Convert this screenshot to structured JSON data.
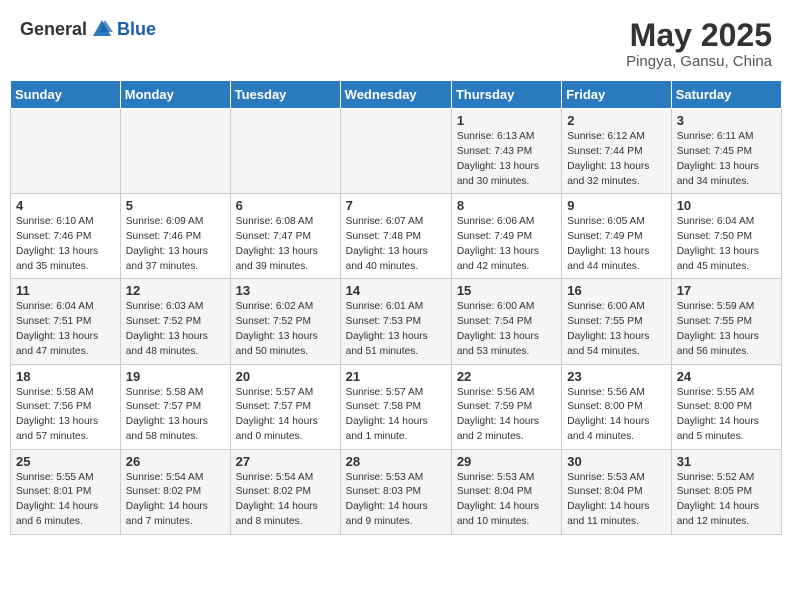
{
  "header": {
    "logo_general": "General",
    "logo_blue": "Blue",
    "month_title": "May 2025",
    "subtitle": "Pingya, Gansu, China"
  },
  "weekdays": [
    "Sunday",
    "Monday",
    "Tuesday",
    "Wednesday",
    "Thursday",
    "Friday",
    "Saturday"
  ],
  "weeks": [
    [
      {
        "day": "",
        "content": ""
      },
      {
        "day": "",
        "content": ""
      },
      {
        "day": "",
        "content": ""
      },
      {
        "day": "",
        "content": ""
      },
      {
        "day": "1",
        "content": "Sunrise: 6:13 AM\nSunset: 7:43 PM\nDaylight: 13 hours\nand 30 minutes."
      },
      {
        "day": "2",
        "content": "Sunrise: 6:12 AM\nSunset: 7:44 PM\nDaylight: 13 hours\nand 32 minutes."
      },
      {
        "day": "3",
        "content": "Sunrise: 6:11 AM\nSunset: 7:45 PM\nDaylight: 13 hours\nand 34 minutes."
      }
    ],
    [
      {
        "day": "4",
        "content": "Sunrise: 6:10 AM\nSunset: 7:46 PM\nDaylight: 13 hours\nand 35 minutes."
      },
      {
        "day": "5",
        "content": "Sunrise: 6:09 AM\nSunset: 7:46 PM\nDaylight: 13 hours\nand 37 minutes."
      },
      {
        "day": "6",
        "content": "Sunrise: 6:08 AM\nSunset: 7:47 PM\nDaylight: 13 hours\nand 39 minutes."
      },
      {
        "day": "7",
        "content": "Sunrise: 6:07 AM\nSunset: 7:48 PM\nDaylight: 13 hours\nand 40 minutes."
      },
      {
        "day": "8",
        "content": "Sunrise: 6:06 AM\nSunset: 7:49 PM\nDaylight: 13 hours\nand 42 minutes."
      },
      {
        "day": "9",
        "content": "Sunrise: 6:05 AM\nSunset: 7:49 PM\nDaylight: 13 hours\nand 44 minutes."
      },
      {
        "day": "10",
        "content": "Sunrise: 6:04 AM\nSunset: 7:50 PM\nDaylight: 13 hours\nand 45 minutes."
      }
    ],
    [
      {
        "day": "11",
        "content": "Sunrise: 6:04 AM\nSunset: 7:51 PM\nDaylight: 13 hours\nand 47 minutes."
      },
      {
        "day": "12",
        "content": "Sunrise: 6:03 AM\nSunset: 7:52 PM\nDaylight: 13 hours\nand 48 minutes."
      },
      {
        "day": "13",
        "content": "Sunrise: 6:02 AM\nSunset: 7:52 PM\nDaylight: 13 hours\nand 50 minutes."
      },
      {
        "day": "14",
        "content": "Sunrise: 6:01 AM\nSunset: 7:53 PM\nDaylight: 13 hours\nand 51 minutes."
      },
      {
        "day": "15",
        "content": "Sunrise: 6:00 AM\nSunset: 7:54 PM\nDaylight: 13 hours\nand 53 minutes."
      },
      {
        "day": "16",
        "content": "Sunrise: 6:00 AM\nSunset: 7:55 PM\nDaylight: 13 hours\nand 54 minutes."
      },
      {
        "day": "17",
        "content": "Sunrise: 5:59 AM\nSunset: 7:55 PM\nDaylight: 13 hours\nand 56 minutes."
      }
    ],
    [
      {
        "day": "18",
        "content": "Sunrise: 5:58 AM\nSunset: 7:56 PM\nDaylight: 13 hours\nand 57 minutes."
      },
      {
        "day": "19",
        "content": "Sunrise: 5:58 AM\nSunset: 7:57 PM\nDaylight: 13 hours\nand 58 minutes."
      },
      {
        "day": "20",
        "content": "Sunrise: 5:57 AM\nSunset: 7:57 PM\nDaylight: 14 hours\nand 0 minutes."
      },
      {
        "day": "21",
        "content": "Sunrise: 5:57 AM\nSunset: 7:58 PM\nDaylight: 14 hours\nand 1 minute."
      },
      {
        "day": "22",
        "content": "Sunrise: 5:56 AM\nSunset: 7:59 PM\nDaylight: 14 hours\nand 2 minutes."
      },
      {
        "day": "23",
        "content": "Sunrise: 5:56 AM\nSunset: 8:00 PM\nDaylight: 14 hours\nand 4 minutes."
      },
      {
        "day": "24",
        "content": "Sunrise: 5:55 AM\nSunset: 8:00 PM\nDaylight: 14 hours\nand 5 minutes."
      }
    ],
    [
      {
        "day": "25",
        "content": "Sunrise: 5:55 AM\nSunset: 8:01 PM\nDaylight: 14 hours\nand 6 minutes."
      },
      {
        "day": "26",
        "content": "Sunrise: 5:54 AM\nSunset: 8:02 PM\nDaylight: 14 hours\nand 7 minutes."
      },
      {
        "day": "27",
        "content": "Sunrise: 5:54 AM\nSunset: 8:02 PM\nDaylight: 14 hours\nand 8 minutes."
      },
      {
        "day": "28",
        "content": "Sunrise: 5:53 AM\nSunset: 8:03 PM\nDaylight: 14 hours\nand 9 minutes."
      },
      {
        "day": "29",
        "content": "Sunrise: 5:53 AM\nSunset: 8:04 PM\nDaylight: 14 hours\nand 10 minutes."
      },
      {
        "day": "30",
        "content": "Sunrise: 5:53 AM\nSunset: 8:04 PM\nDaylight: 14 hours\nand 11 minutes."
      },
      {
        "day": "31",
        "content": "Sunrise: 5:52 AM\nSunset: 8:05 PM\nDaylight: 14 hours\nand 12 minutes."
      }
    ]
  ]
}
